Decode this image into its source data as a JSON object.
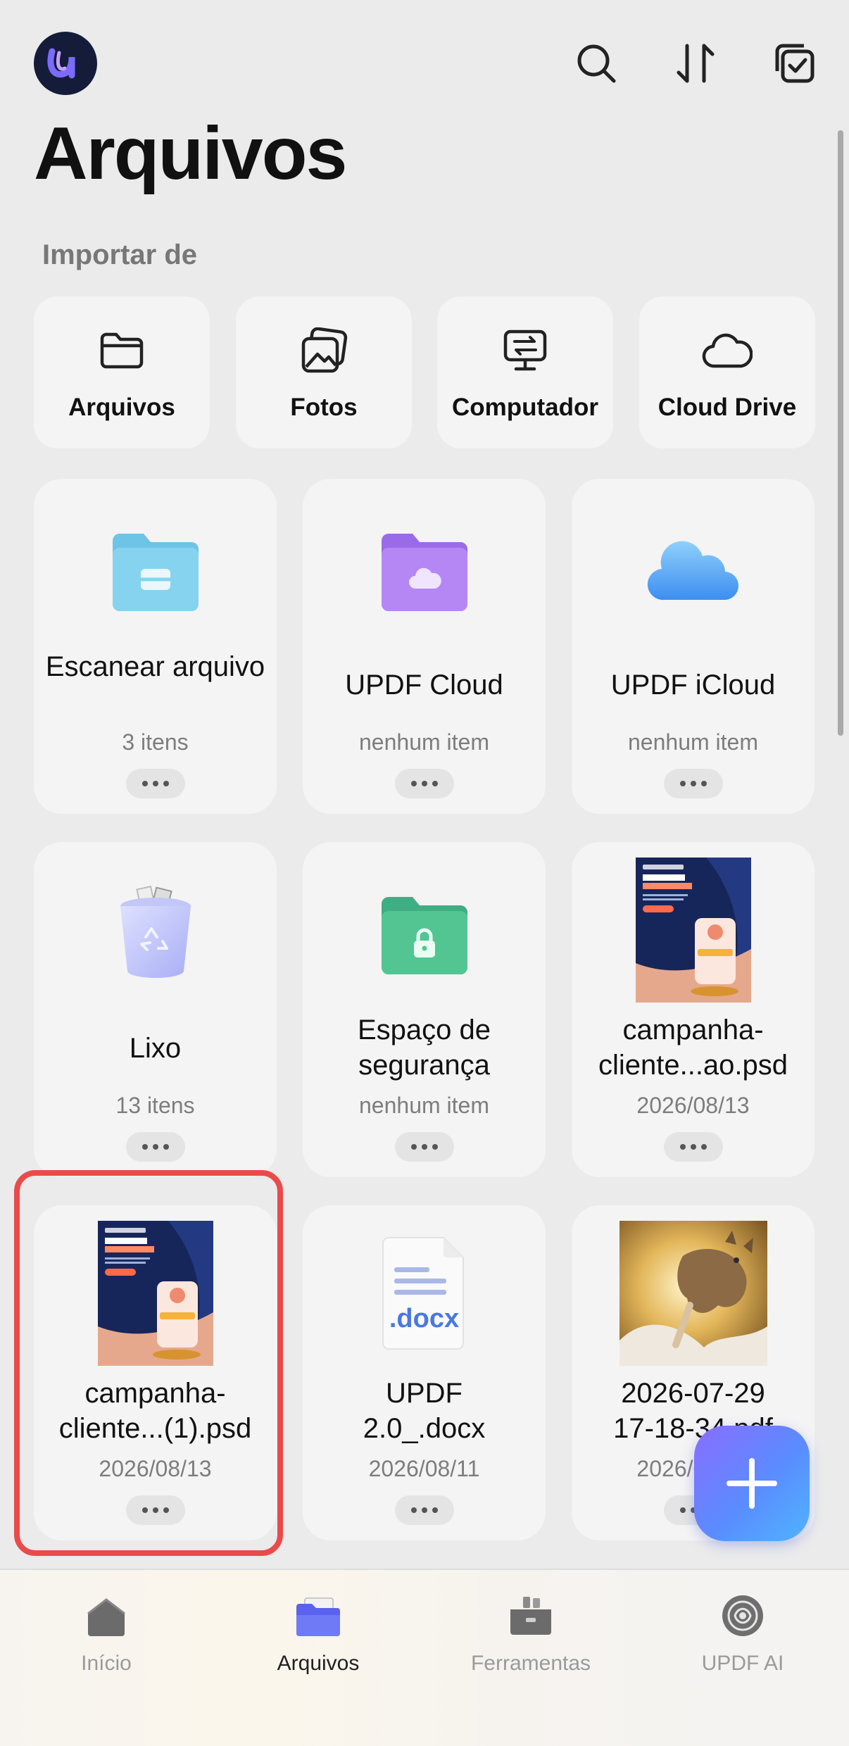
{
  "header": {
    "title": "Arquivos",
    "import_label": "Importar de",
    "icons": [
      "app-logo",
      "search-icon",
      "sort-icon",
      "select-icon"
    ]
  },
  "import_sources": [
    {
      "label": "Arquivos",
      "icon": "folder-icon"
    },
    {
      "label": "Fotos",
      "icon": "photos-icon"
    },
    {
      "label": "Computador",
      "icon": "computer-transfer-icon"
    },
    {
      "label": "Cloud Drive",
      "icon": "cloud-icon"
    }
  ],
  "items": [
    {
      "name": "Escanear arquivo",
      "meta": "3 itens",
      "icon": "scan-folder-icon"
    },
    {
      "name": "UPDF Cloud",
      "meta": "nenhum item",
      "icon": "updf-cloud-folder-icon"
    },
    {
      "name": "UPDF iCloud",
      "meta": "nenhum item",
      "icon": "icloud-icon"
    },
    {
      "name": "Lixo",
      "meta": "13 itens",
      "icon": "trash-icon"
    },
    {
      "name": "Espaço de segurança",
      "meta": "nenhum item",
      "icon": "secure-folder-icon"
    },
    {
      "name": "campanha-\ncliente...ao.psd",
      "meta": "2026/08/13",
      "icon": "psd-thumbnail"
    },
    {
      "name": "campanha-\ncliente...(1).psd",
      "meta": "2026/08/13",
      "icon": "psd-thumbnail"
    },
    {
      "name": "UPDF\n2.0_.docx",
      "meta": "2026/08/11",
      "icon": "docx-icon",
      "badge": ".docx"
    },
    {
      "name": "2026-07-29\n17-18-34.pdf",
      "meta": "2026/08/13",
      "icon": "image-thumbnail"
    }
  ],
  "thumb_text": {
    "tag": "CAMPANHA DE AVALIAÇÃO",
    "headline": "A sua opinião",
    "headline2": "faz a diferença.",
    "button": "DEIXE SUA AVALIAÇÃO"
  },
  "tabs": [
    {
      "label": "Início",
      "icon": "home-icon",
      "active": false
    },
    {
      "label": "Arquivos",
      "icon": "files-icon",
      "active": true
    },
    {
      "label": "Ferramentas",
      "icon": "tools-icon",
      "active": false
    },
    {
      "label": "UPDF AI",
      "icon": "ai-icon",
      "active": false
    }
  ],
  "colors": {
    "accent": "#5a6cf0",
    "highlight": "#ea4a4a",
    "background": "#ebebeb"
  }
}
